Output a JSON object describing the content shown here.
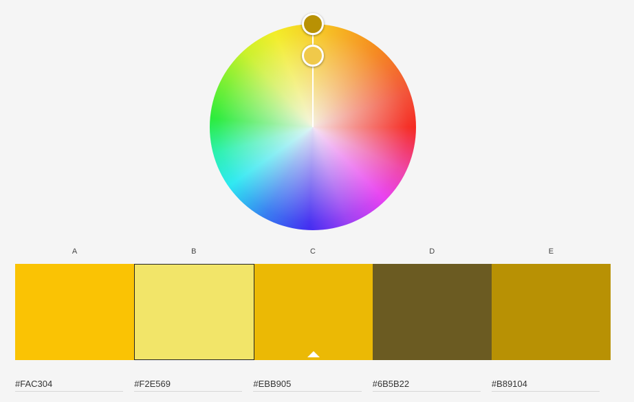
{
  "wheel": {
    "base_handle_color": "#B89104",
    "second_handle_color": "#F0C94A"
  },
  "swatches": [
    {
      "label": "A",
      "color": "#FAC304",
      "hex": "#FAC304",
      "selected": false
    },
    {
      "label": "B",
      "color": "#F2E569",
      "hex": "#F2E569",
      "selected": true
    },
    {
      "label": "C",
      "color": "#EBB905",
      "hex": "#EBB905",
      "selected": false,
      "base": true
    },
    {
      "label": "D",
      "color": "#6B5B22",
      "hex": "#6B5B22",
      "selected": false
    },
    {
      "label": "E",
      "color": "#B89104",
      "hex": "#B89104",
      "selected": false
    }
  ]
}
